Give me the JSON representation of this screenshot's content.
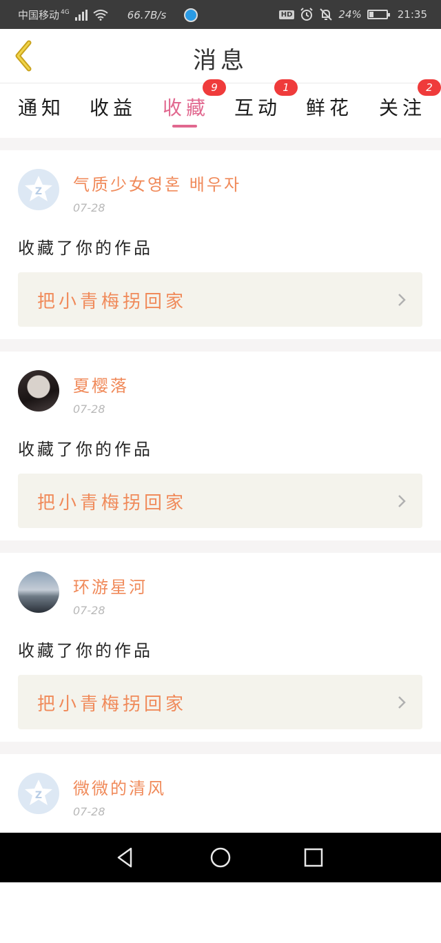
{
  "status_bar": {
    "carrier": "中国移动",
    "network": "4G",
    "speed": "66.7B/s",
    "battery": "24%",
    "battery_level": 0.24,
    "time": "21:35",
    "hd": "HD"
  },
  "header": {
    "title": "消息"
  },
  "tabs": [
    {
      "label": "通知",
      "badge": ""
    },
    {
      "label": "收益",
      "badge": ""
    },
    {
      "label": "收藏",
      "badge": "9"
    },
    {
      "label": "互动",
      "badge": "1"
    },
    {
      "label": "鲜花",
      "badge": ""
    },
    {
      "label": "关注",
      "badge": "2"
    }
  ],
  "active_tab": "收藏",
  "colors": {
    "accent": "#e1688f",
    "name_orange": "#f08a5a",
    "badge_red": "#ef3b3b",
    "card_bg": "#f4f3ec"
  },
  "items": [
    {
      "user": "气质少女영혼 배우자",
      "date": "07-28",
      "action": "收藏了你的作品",
      "work": "把小青梅拐回家",
      "avatar": "default-avatar-icon"
    },
    {
      "user": "夏樱落",
      "date": "07-28",
      "action": "收藏了你的作品",
      "work": "把小青梅拐回家",
      "avatar": "user-photo"
    },
    {
      "user": "环游星河",
      "date": "07-28",
      "action": "收藏了你的作品",
      "work": "把小青梅拐回家",
      "avatar": "user-photo"
    },
    {
      "user": "微微的清风",
      "date": "07-28",
      "action": "",
      "work": "",
      "avatar": "default-avatar-icon"
    }
  ]
}
